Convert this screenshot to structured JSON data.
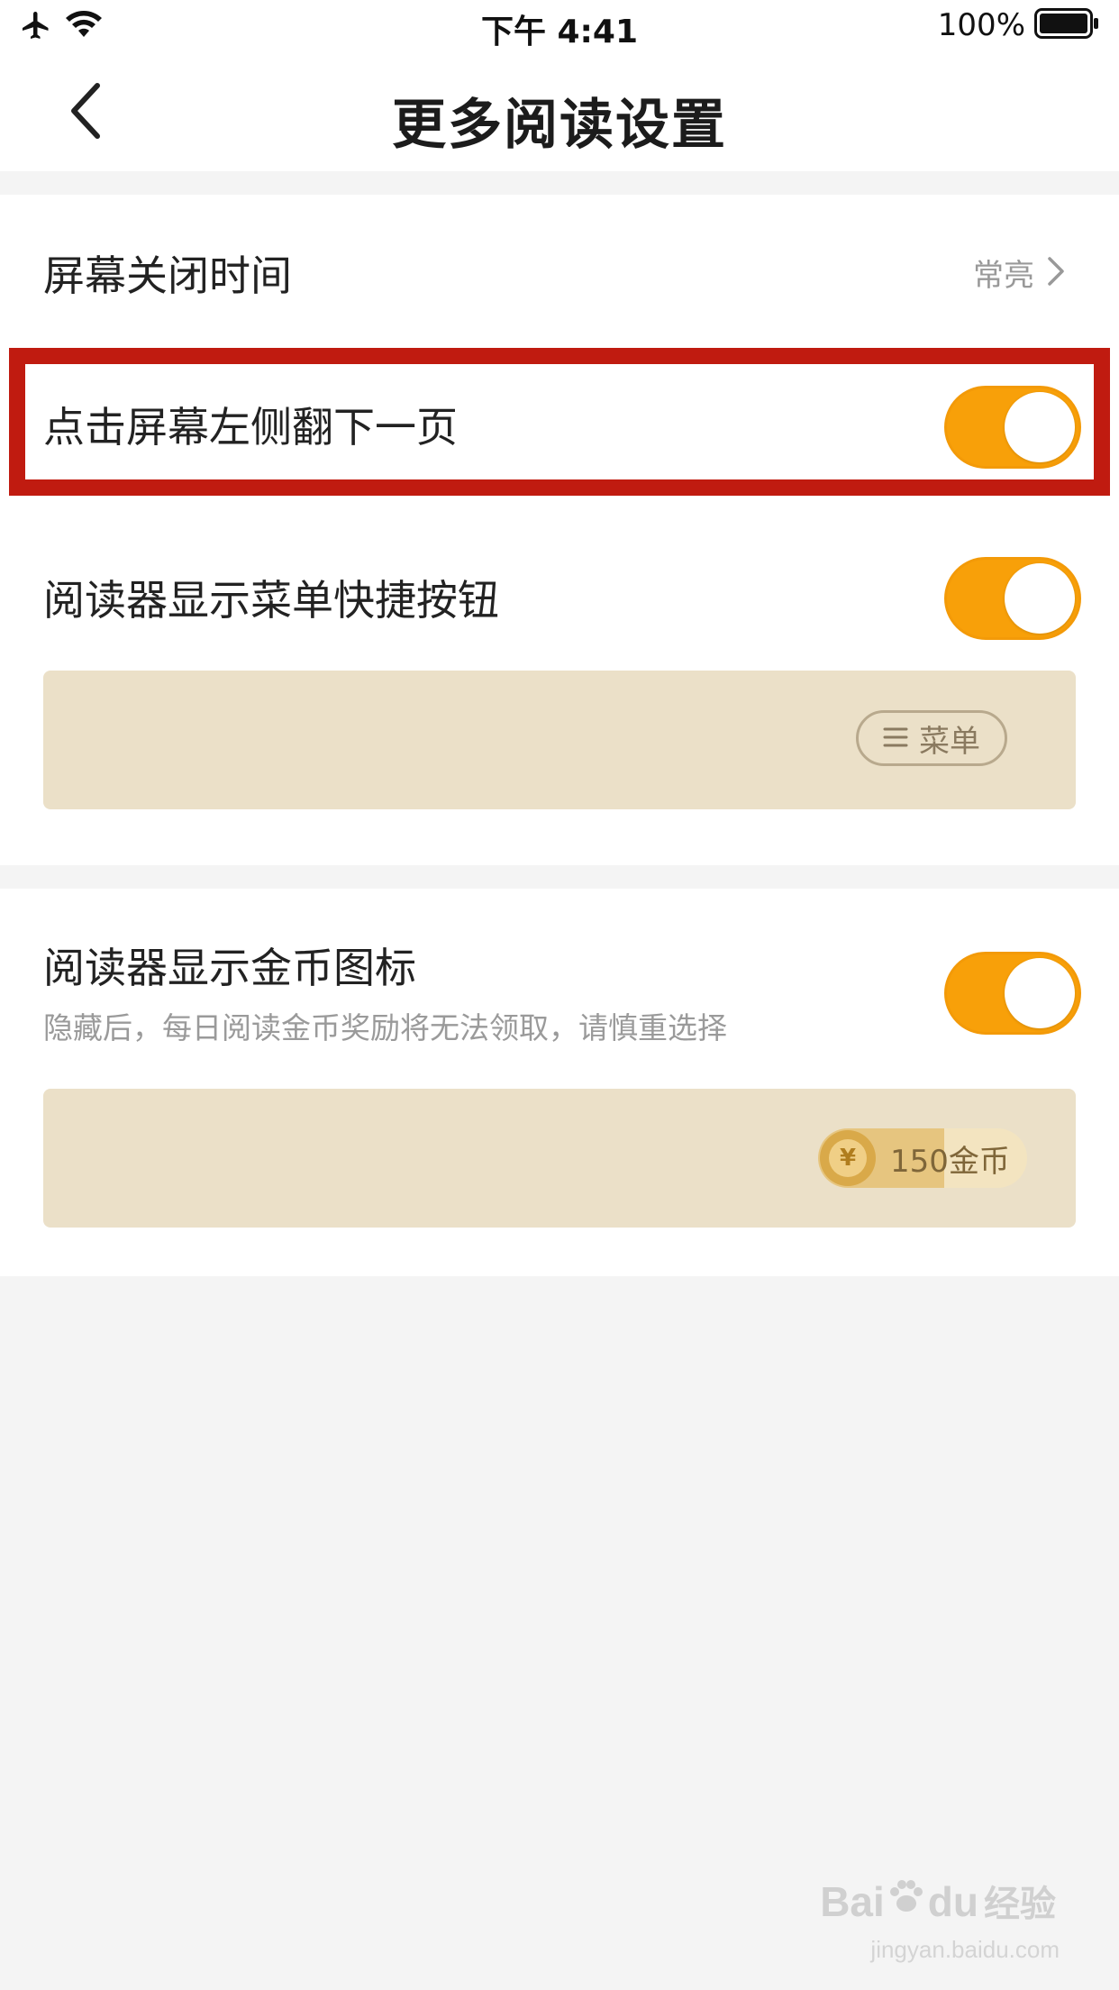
{
  "status_bar": {
    "time": "下午 4:41",
    "battery_percent": "100%",
    "icons": [
      "airplane-icon",
      "wifi-icon",
      "battery-icon"
    ]
  },
  "nav": {
    "title": "更多阅读设置",
    "back_icon": "chevron-left-icon"
  },
  "settings": {
    "screen_off": {
      "label": "屏幕关闭时间",
      "value": "常亮"
    },
    "tap_left_next": {
      "label": "点击屏幕左侧翻下一页",
      "enabled": true
    },
    "menu_shortcut": {
      "label": "阅读器显示菜单快捷按钮",
      "enabled": true,
      "preview_button": "菜单"
    },
    "coin_icon": {
      "label": "阅读器显示金币图标",
      "description": "隐藏后，每日阅读金币奖励将无法领取，请慎重选择",
      "enabled": true,
      "preview_coin_symbol": "¥",
      "preview_coin_text": "150金币"
    }
  },
  "colors": {
    "accent": "#f8a009",
    "highlight": "#c01b10",
    "preview_bg": "#ebe0c8"
  },
  "watermark": {
    "brand": "Bai",
    "brand_suffix": "du",
    "brand_cn": "经验",
    "url": "jingyan.baidu.com"
  }
}
